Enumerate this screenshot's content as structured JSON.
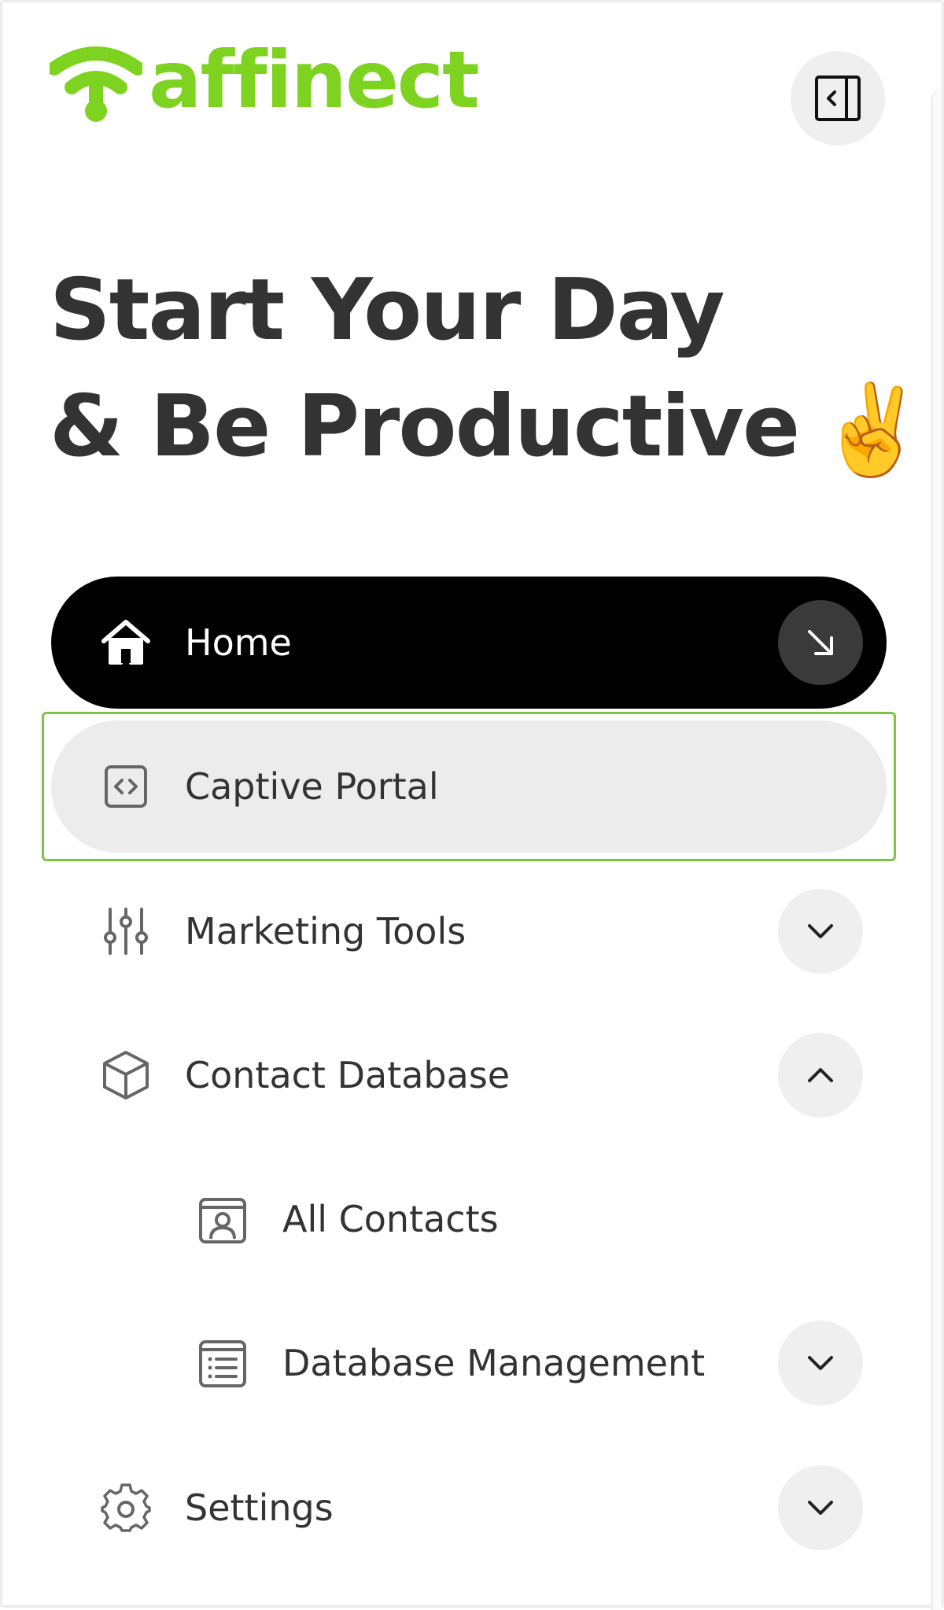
{
  "brand": {
    "name": "affinect",
    "color": "#7ed321"
  },
  "header": {
    "collapse_icon": "sidebar-collapse-icon"
  },
  "greeting": {
    "line1": "Start Your Day",
    "line2": "& Be Productive",
    "emoji": "✌️"
  },
  "nav": {
    "home": {
      "label": "Home",
      "icon": "home-icon",
      "trail_icon": "arrow-down-right-icon"
    },
    "captive_portal": {
      "label": "Captive Portal",
      "icon": "code-icon"
    },
    "marketing_tools": {
      "label": "Marketing Tools",
      "icon": "sliders-icon",
      "trail_icon": "chevron-down-icon"
    },
    "contact_database": {
      "label": "Contact Database",
      "icon": "cube-icon",
      "trail_icon": "chevron-up-icon",
      "children": {
        "all_contacts": {
          "label": "All Contacts",
          "icon": "contact-card-icon"
        },
        "database_management": {
          "label": "Database Management",
          "icon": "list-icon",
          "trail_icon": "chevron-down-icon"
        }
      }
    },
    "settings": {
      "label": "Settings",
      "icon": "gear-icon",
      "trail_icon": "chevron-down-icon"
    }
  },
  "colors": {
    "active_bg": "#000000",
    "hover_bg": "#ececec",
    "focus_ring": "#7bc53f"
  }
}
